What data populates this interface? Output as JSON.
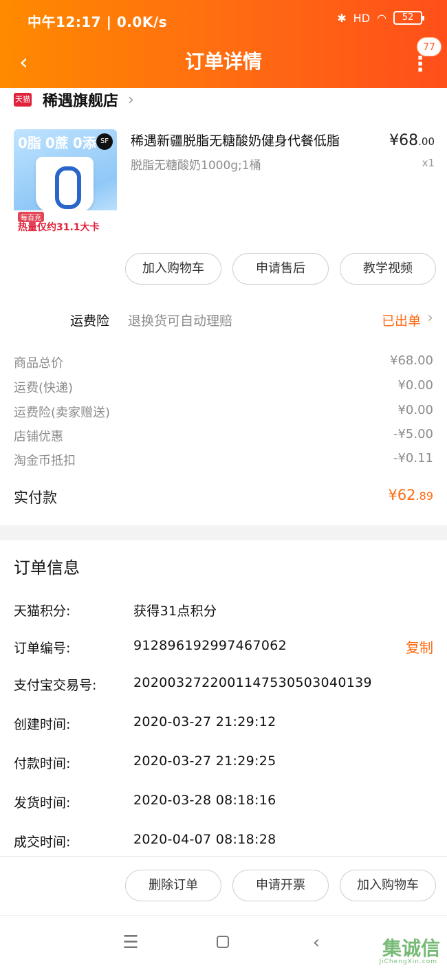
{
  "status_bar": {
    "left": "中午12:17 | 0.0K/s",
    "signal": "HD",
    "battery": "52"
  },
  "nav": {
    "back_icon": "‹",
    "title": "订单详情",
    "more_icon": "⋮",
    "badge": "77"
  },
  "shop": {
    "logo_text": "天猫",
    "name": "稀遇旗舰店",
    "chevron": "›"
  },
  "product": {
    "image_overlay_top": [
      "0脂",
      "0蔗",
      "0添"
    ],
    "image_sf": "SF",
    "image_tag": "每百克",
    "image_text": "热量仅约31.1大卡",
    "title": "稀遇新疆脱脂无糖酸奶健身代餐低脂",
    "sku": "脱脂无糖酸奶1000g;1桶",
    "price_main": "¥68",
    "price_dec": ".00",
    "qty": "x1"
  },
  "product_actions": [
    {
      "label": "加入购物车"
    },
    {
      "label": "申请售后"
    },
    {
      "label": "教学视频"
    }
  ],
  "insurance": {
    "label": "运费险",
    "desc": "退换货可自动理赔",
    "status": "已出单",
    "chevron": "›"
  },
  "costs": [
    {
      "label": "商品总价",
      "value": "¥68.00"
    },
    {
      "label": "运费(快递)",
      "value": "¥0.00"
    },
    {
      "label": "运费险(卖家赠送)",
      "value": "¥0.00"
    },
    {
      "label": "店铺优惠",
      "value": "-¥5.00"
    },
    {
      "label": "淘金币抵扣",
      "value": "-¥0.11"
    }
  ],
  "paid": {
    "label": "实付款",
    "value_main": "¥62",
    "value_dec": ".89"
  },
  "order_info": {
    "title": "订单信息",
    "rows": [
      {
        "label": "天猫积分:",
        "value": "获得31点积分"
      },
      {
        "label": "订单编号:",
        "value": "912896192997467062"
      },
      {
        "label": "支付宝交易号:",
        "value": "2020032722001147530503040139"
      },
      {
        "label": "创建时间:",
        "value": "2020-03-27 21:29:12"
      },
      {
        "label": "付款时间:",
        "value": "2020-03-27 21:29:25"
      },
      {
        "label": "发货时间:",
        "value": "2020-03-28 08:18:16"
      },
      {
        "label": "成交时间:",
        "value": "2020-04-07 08:18:28"
      }
    ],
    "copy_label": "复制"
  },
  "bottom_actions": [
    {
      "label": "删除订单"
    },
    {
      "label": "申请开票"
    },
    {
      "label": "加入购物车"
    }
  ],
  "system_nav": {
    "menu_icon": "☰",
    "back_icon": "‹"
  },
  "watermark": {
    "text": "集诚信",
    "sub": "JiChengXin.com"
  },
  "colors": {
    "header_start": "#ff8a00",
    "header_end": "#ff4f1a",
    "accent": "#ff6a12",
    "tmall_red": "#e0223b"
  }
}
